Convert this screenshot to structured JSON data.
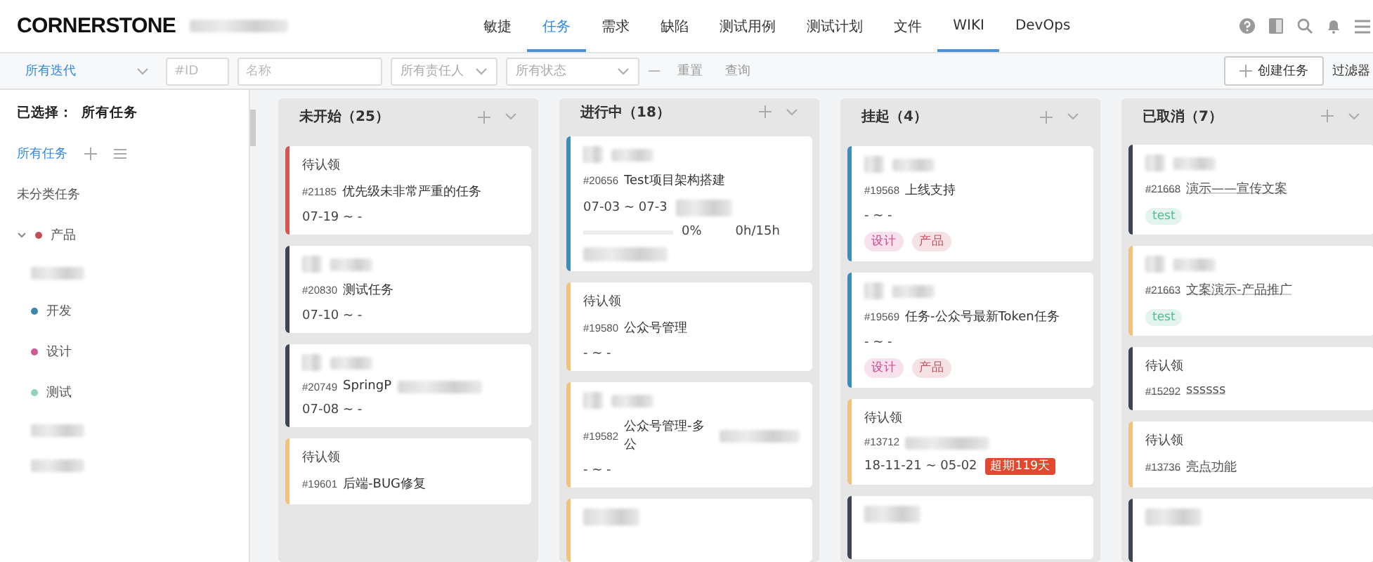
{
  "brand": "CORNERSTONE",
  "nav": [
    {
      "label": "敏捷",
      "selected": false,
      "marked": false
    },
    {
      "label": "任务",
      "selected": true,
      "marked": true
    },
    {
      "label": "需求",
      "selected": false,
      "marked": false
    },
    {
      "label": "缺陷",
      "selected": false,
      "marked": false
    },
    {
      "label": "测试用例",
      "selected": false,
      "marked": false
    },
    {
      "label": "测试计划",
      "selected": false,
      "marked": false
    },
    {
      "label": "文件",
      "selected": false,
      "marked": false
    },
    {
      "label": "WIKI",
      "selected": false,
      "marked": true
    },
    {
      "label": "DevOps",
      "selected": false,
      "marked": false
    }
  ],
  "filters": {
    "sprint": "所有迭代",
    "id_placeholder": "#ID",
    "name_placeholder": "名称",
    "owner": "所有责任人",
    "status": "所有状态",
    "separator": "—",
    "reset": "重置",
    "query": "查询",
    "create": "创建任务",
    "filter": "过滤器"
  },
  "sidebar": {
    "selected_label": "已选择：",
    "selected_value": "所有任务",
    "all": "所有任务",
    "uncategorized": "未分类任务",
    "tree": [
      {
        "kind": "item",
        "label": "产品",
        "color": "#c0505c",
        "expanded": true,
        "children": [
          {
            "kind": "blurred"
          },
          {
            "kind": "item",
            "label": "开发",
            "color": "#3c86ad"
          },
          {
            "kind": "item",
            "label": "设计",
            "color": "#d05a93"
          },
          {
            "kind": "item",
            "label": "测试",
            "color": "#8fd3b8"
          },
          {
            "kind": "blurred"
          },
          {
            "kind": "blurred"
          }
        ]
      }
    ]
  },
  "columns": [
    {
      "title": "未开始（25）",
      "cards": [
        {
          "color": "#d9534f",
          "assignee": "待认领",
          "id": "#21185",
          "title": "优先级未非常严重的任务",
          "date": "07-19 ~ -"
        },
        {
          "color": "#3d4453",
          "id": "#20830",
          "title": "测试任务",
          "date": "07-10 ~ -"
        },
        {
          "color": "#3d4453",
          "id": "#20749",
          "title": "SpringP",
          "date": "07-08 ~ -"
        },
        {
          "color": "#f0c27b",
          "assignee": "待认领",
          "id": "#19601",
          "title": "后端-BUG修复"
        }
      ]
    },
    {
      "title": "进行中（18）",
      "cards": [
        {
          "color": "#3c8dbc",
          "id": "#20656",
          "title": "Test项目架构搭建",
          "date": "07-03 ~ 07-3",
          "progress": {
            "level": 0,
            "percent": "0%",
            "hours": "0h/15h"
          }
        },
        {
          "color": "#f0c27b",
          "assignee": "待认领",
          "id": "#19580",
          "title": "公众号管理",
          "date": "- ~ -"
        },
        {
          "color": "#f0c27b",
          "id": "#19582",
          "title": "公众号管理-多公",
          "date": "- ~ -"
        },
        {
          "color": "#f0c27b"
        }
      ]
    },
    {
      "title": "挂起（4）",
      "cards": [
        {
          "color": "#3c8dbc",
          "id": "#19568",
          "title": "上线支持",
          "date": "- ~ -",
          "tags": [
            {
              "label": "设计",
              "color": "#d0468a"
            },
            {
              "label": "产品",
              "color": "#c0505c"
            }
          ]
        },
        {
          "color": "#3c8dbc",
          "id": "#19569",
          "title": "任务-公众号最新Token任务",
          "date": "- ~ -",
          "tags": [
            {
              "label": "设计",
              "color": "#d0468a"
            },
            {
              "label": "产品",
              "color": "#c0505c"
            }
          ]
        },
        {
          "color": "#f0c27b",
          "assignee": "待认领",
          "id": "#13712",
          "date": "18-11-21 ~ 05-02",
          "overdue": "超期119天"
        },
        {
          "color": "#3d4453"
        }
      ]
    },
    {
      "title": "已取消（7）",
      "cards": [
        {
          "color": "#3d4453",
          "id": "#21668",
          "title": "演示——宣传文案",
          "struck": true,
          "tags": [
            {
              "label": "test",
              "color": "#4cbf94"
            }
          ]
        },
        {
          "color": "#f0c27b",
          "id": "#21663",
          "title": "文案演示-产品推广",
          "struck": true,
          "tags": [
            {
              "label": "test",
              "color": "#4cbf94"
            }
          ]
        },
        {
          "color": "#3d4453",
          "assignee": "待认领",
          "id": "#15292",
          "title": "ssssss",
          "struck": true
        },
        {
          "color": "#f0c27b",
          "assignee": "待认领",
          "id": "#13736",
          "title": "亮点功能",
          "struck": true
        },
        {
          "color": "#3d4453"
        }
      ]
    }
  ]
}
